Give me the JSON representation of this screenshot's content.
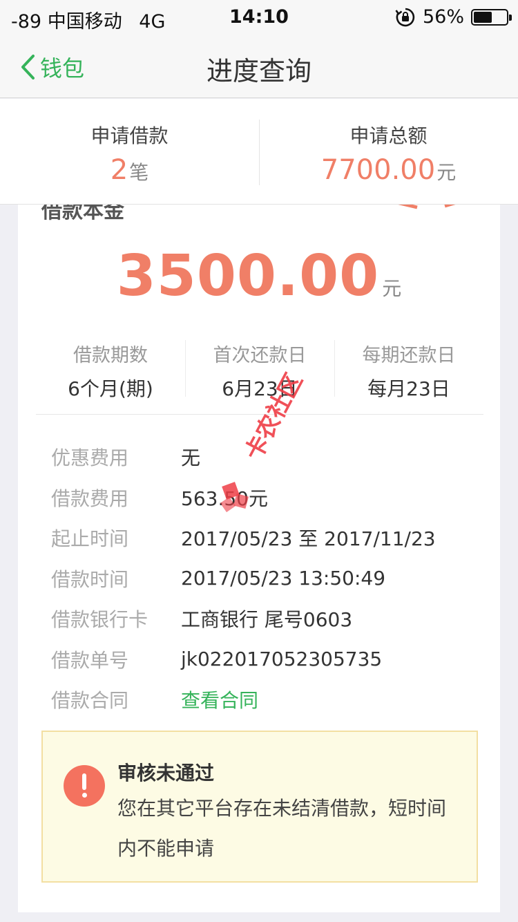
{
  "status_bar": {
    "signal": "-89",
    "carrier": "中国移动",
    "network": "4G",
    "time": "14:10",
    "battery": "56%",
    "battery_level": 0.56
  },
  "nav": {
    "back_label": "钱包",
    "title": "进度查询"
  },
  "summary": {
    "count_label": "申请借款",
    "count_value": "2",
    "count_unit": "笔",
    "total_label": "申请总额",
    "total_value": "7700.00",
    "total_unit": "元"
  },
  "card": {
    "header_label": "借款本金",
    "amount": "3500.00",
    "amount_unit": "元",
    "terms": [
      {
        "label": "借款期数",
        "value": "6个月(期)"
      },
      {
        "label": "首次还款日",
        "value": "6月23日"
      },
      {
        "label": "每期还款日",
        "value": "每月23日"
      }
    ],
    "details": [
      {
        "label": "优惠费用",
        "value": "无"
      },
      {
        "label": "借款费用",
        "value": "563.50元"
      },
      {
        "label": "起止时间",
        "value": "2017/05/23 至 2017/11/23"
      },
      {
        "label": "借款时间",
        "value": "2017/05/23 13:50:49"
      },
      {
        "label": "借款银行卡",
        "value": "工商银行 尾号0603"
      },
      {
        "label": "借款单号",
        "value": "jk022017052305735"
      },
      {
        "label": "借款合同",
        "value": "查看合同"
      }
    ],
    "notice": {
      "title": "审核未通过",
      "text": "您在其它平台存在未结清借款，短时间内不能申请"
    }
  },
  "watermark": {
    "text": "卡农社区"
  },
  "colors": {
    "accent_green": "#35b35a",
    "amount_orange": "#f07f67",
    "notice_bg": "#fdfbe4",
    "notice_icon": "#f4725f"
  }
}
